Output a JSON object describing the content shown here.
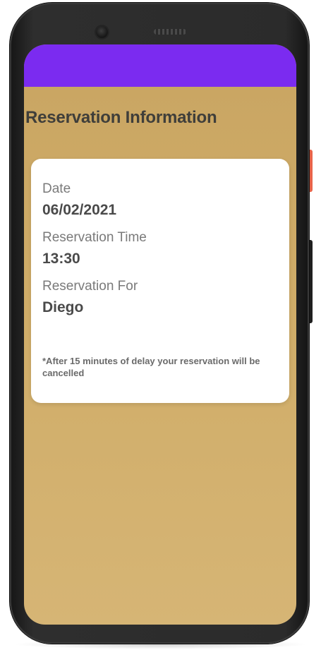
{
  "screen": {
    "title": "Reservation Information",
    "app_bar_color": "#7b2bf0",
    "background_color": "#cfac68"
  },
  "reservation": {
    "date_label": "Date",
    "date_value": "06/02/2021",
    "time_label": "Reservation Time",
    "time_value": "13:30",
    "for_label": "Reservation For",
    "for_value": "Diego",
    "note": "*After 15 minutes of delay your reservation will be cancelled"
  },
  "device": {
    "power_button_color": "#e8644a"
  }
}
